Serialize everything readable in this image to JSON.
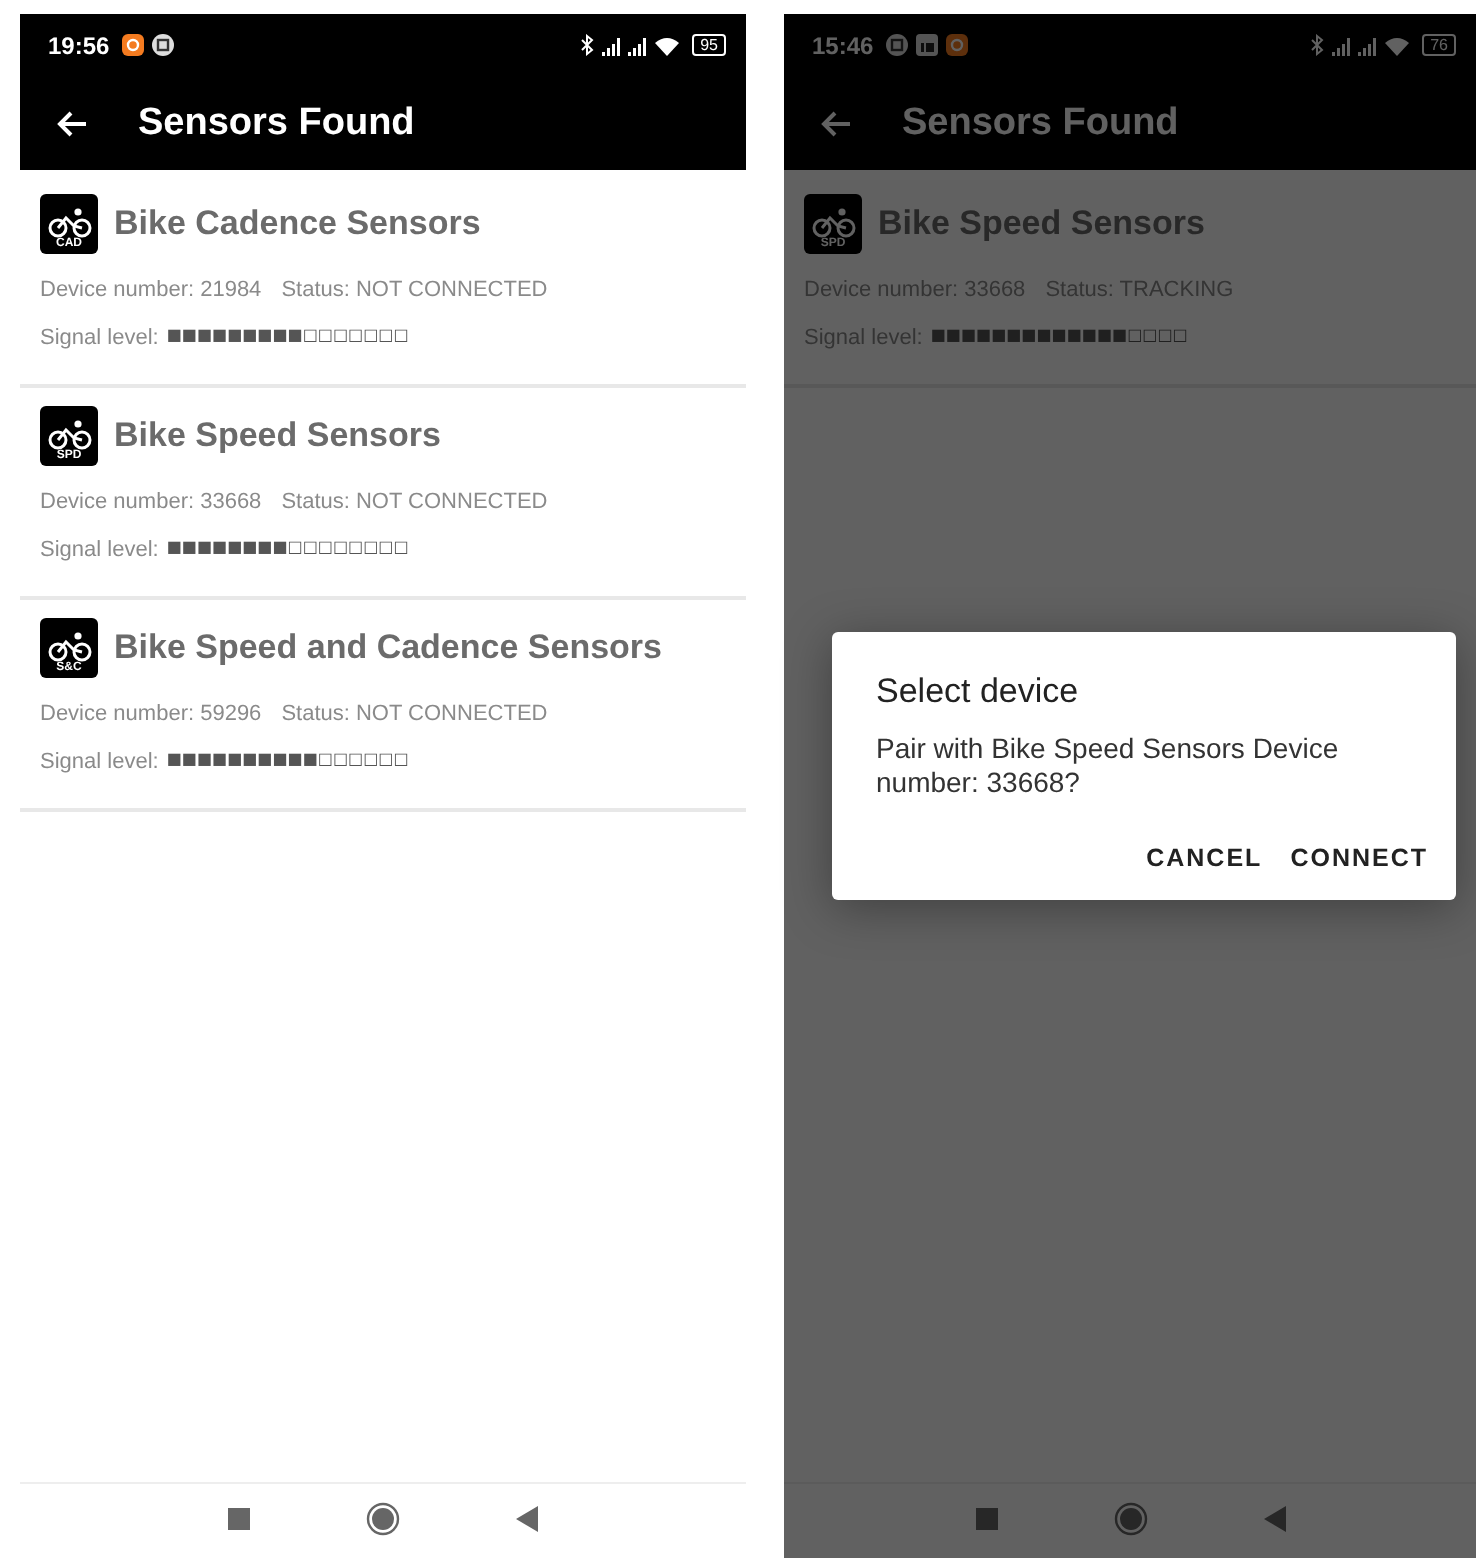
{
  "screens": [
    {
      "dimmed": false,
      "status_bar": {
        "time": "19:56",
        "notifications": [
          {
            "kind": "orange"
          },
          {
            "kind": "circle"
          }
        ],
        "battery": "95"
      },
      "app_bar": {
        "title": "Sensors Found"
      },
      "sensors": [
        {
          "badge": "CAD",
          "name": "Bike Cadence Sensors",
          "device_number": "Device number: 21984",
          "status": "Status: NOT CONNECTED",
          "signal_label": "Signal level:",
          "signal": "■■■■■■■■■□□□□□□□"
        },
        {
          "badge": "SPD",
          "name": "Bike Speed Sensors",
          "device_number": "Device number: 33668",
          "status": "Status: NOT CONNECTED",
          "signal_label": "Signal level:",
          "signal": "■■■■■■■■□□□□□□□□"
        },
        {
          "badge": "S&C",
          "name": "Bike Speed and Cadence Sensors",
          "device_number": "Device number: 59296",
          "status": "Status: NOT CONNECTED",
          "signal_label": "Signal level:",
          "signal": "■■■■■■■■■■□□□□□□"
        }
      ]
    },
    {
      "dimmed": true,
      "status_bar": {
        "time": "15:46",
        "notifications": [
          {
            "kind": "circle"
          },
          {
            "kind": "square"
          },
          {
            "kind": "orange"
          }
        ],
        "battery": "76"
      },
      "app_bar": {
        "title": "Sensors Found"
      },
      "sensors": [
        {
          "badge": "SPD",
          "name": "Bike Speed Sensors",
          "device_number": "Device number: 33668",
          "status": "Status: TRACKING",
          "signal_label": "Signal level:",
          "signal": "■■■■■■■■■■■■■□□□□"
        }
      ],
      "dialog": {
        "title": "Select device",
        "message": "Pair with Bike Speed Sensors Device number: 33668?",
        "buttons": [
          "CANCEL",
          "CONNECT"
        ]
      }
    }
  ]
}
